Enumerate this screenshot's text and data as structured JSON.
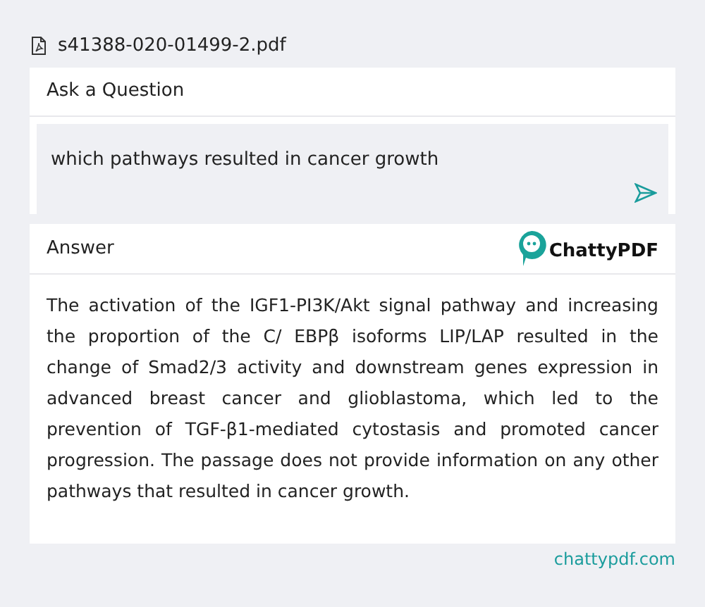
{
  "file": {
    "name": "s41388-020-01499-2.pdf"
  },
  "question": {
    "title": "Ask a Question",
    "value": "which pathways resulted in cancer growth"
  },
  "answer": {
    "title": "Answer",
    "logo": "ChattyPDF",
    "text": "The activation of the IGF1-PI3K/Akt signal pathway and increasing the proportion of the C/ EBPβ isoforms LIP/LAP resulted in the change of Smad2/3 activity and downstream genes expression in advanced breast cancer and glioblastoma, which led to the prevention of TGF-β1-mediated cytostasis and promoted cancer progression. The passage does not provide information on any other pathways that resulted in cancer growth."
  },
  "footer": {
    "link": "chattypdf.com"
  }
}
